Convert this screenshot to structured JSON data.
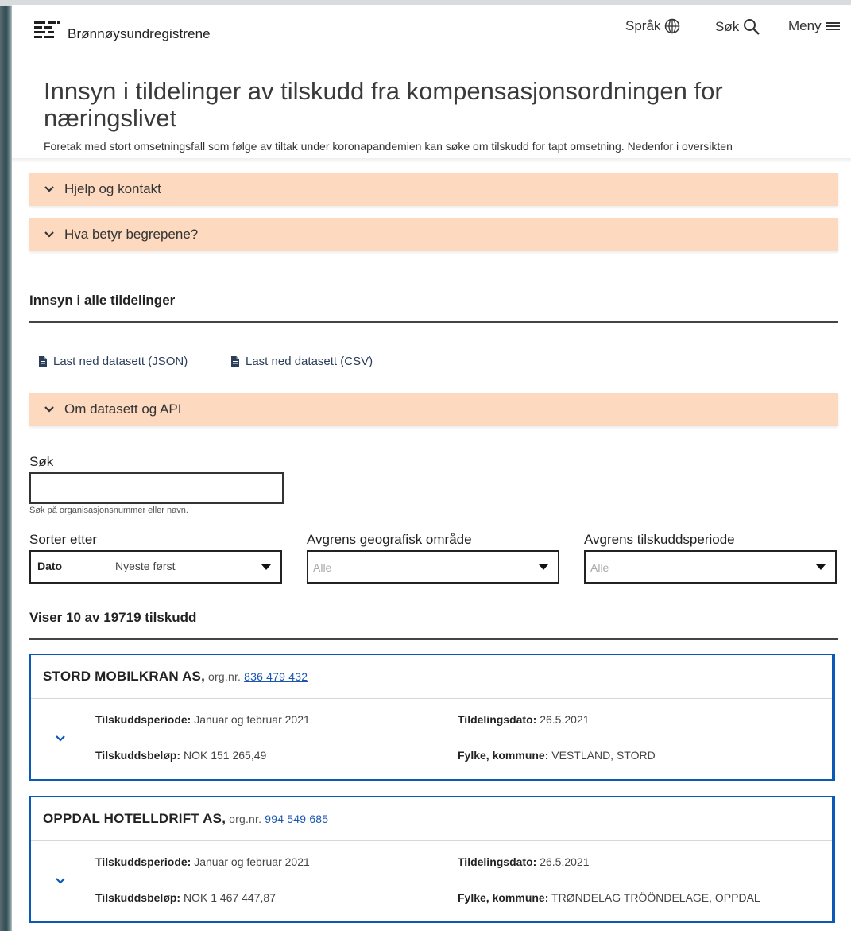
{
  "header": {
    "logo_text": "Brønnøysundregistrene",
    "lang_label": "Språk",
    "search_label": "Søk",
    "menu_label": "Meny"
  },
  "page": {
    "title": "Innsyn i tildelinger av tilskudd fra kompensasjonsordningen for næringslivet",
    "lead": "Foretak med stort omsetningsfall som følge av tiltak under koronapandemien kan søke om tilskudd for tapt omsetning. Nedenfor i oversikten"
  },
  "accordions": {
    "help": "Hjelp og kontakt",
    "terms": "Hva betyr begrepene?",
    "api": "Om datasett og API"
  },
  "section": {
    "heading": "Innsyn i alle tildelinger",
    "download_json": "Last ned datasett (JSON)",
    "download_csv": "Last ned datasett (CSV)"
  },
  "search": {
    "label": "Søk",
    "value": "",
    "hint": "Søk på organisasjonsnummer eller navn."
  },
  "filters": {
    "sort_label": "Sorter etter",
    "sort_field": "Dato",
    "sort_order": "Nyeste først",
    "geo_label": "Avgrens geografisk område",
    "geo_placeholder": "Alle",
    "period_label": "Avgrens tilskuddsperiode",
    "period_placeholder": "Alle"
  },
  "results": {
    "count_text": "Viser 10 av 19719 tilskudd",
    "labels": {
      "period": "Tilskuddsperiode:",
      "amount": "Tilskuddsbeløp:",
      "date": "Tildelingsdato:",
      "county": "Fylke, kommune:",
      "org": "org.nr."
    },
    "items": [
      {
        "name": "STORD MOBILKRAN AS,",
        "orgnr": "836 479 432",
        "period": "Januar og februar 2021",
        "amount": "NOK 151 265,49",
        "date": "26.5.2021",
        "county": "VESTLAND, STORD"
      },
      {
        "name": "OPPDAL HOTELLDRIFT AS,",
        "orgnr": "994 549 685",
        "period": "Januar og februar 2021",
        "amount": "NOK 1 467 447,87",
        "date": "26.5.2021",
        "county": "TRØNDELAG TRÖÖNDELAGE, OPPDAL"
      }
    ]
  },
  "colors": {
    "accordion_bg": "#fcd9bf",
    "card_border": "#0a58b8",
    "link": "#1a56b0"
  }
}
